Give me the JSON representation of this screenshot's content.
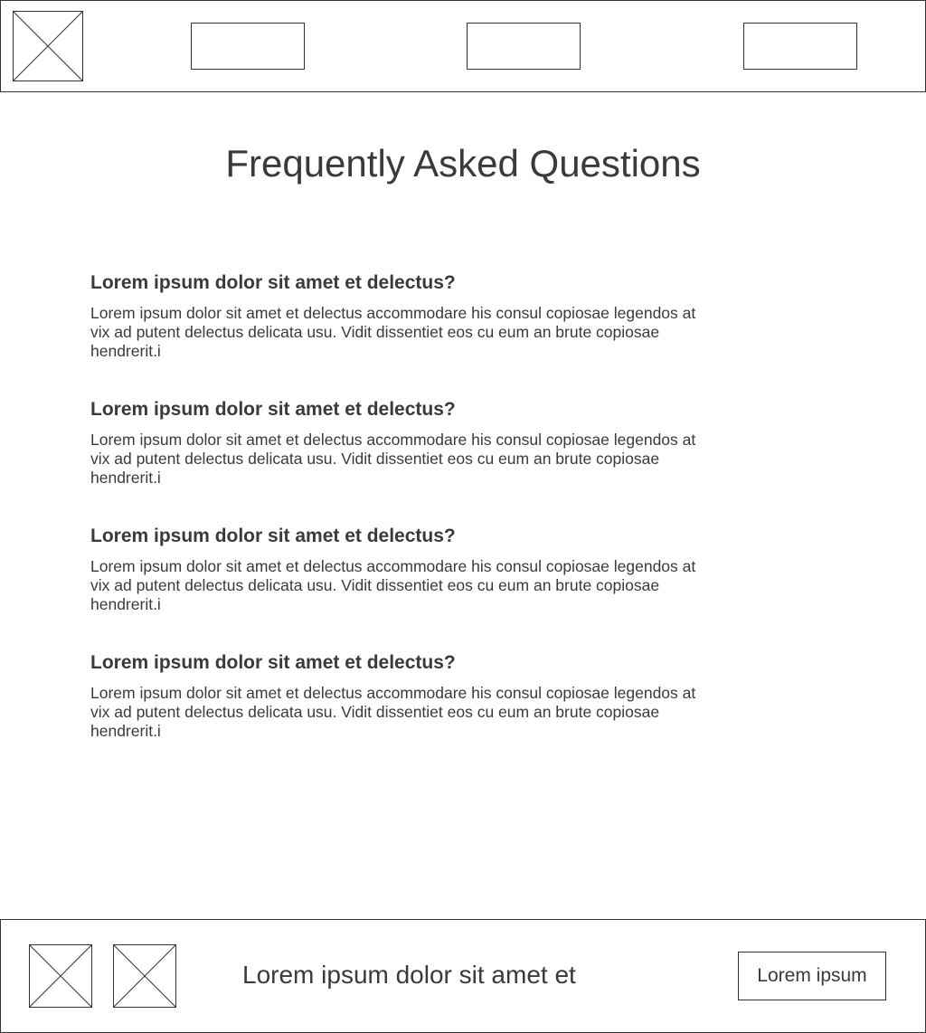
{
  "header": {
    "nav_items": [
      "",
      "",
      ""
    ]
  },
  "main": {
    "title": "Frequently Asked Questions",
    "faq": [
      {
        "question": "Lorem ipsum dolor sit amet et delectus?",
        "answer": "Lorem ipsum dolor sit amet et delectus accommodare his consul copiosae legendos at vix ad putent delectus delicata usu. Vidit dissentiet eos cu eum an brute copiosae hendrerit.i"
      },
      {
        "question": "Lorem ipsum dolor sit amet et delectus?",
        "answer": "Lorem ipsum dolor sit amet et delectus accommodare his consul copiosae legendos at vix ad putent delectus delicata usu. Vidit dissentiet eos cu eum an brute copiosae hendrerit.i"
      },
      {
        "question": "Lorem ipsum dolor sit amet et delectus?",
        "answer": "Lorem ipsum dolor sit amet et delectus accommodare his consul copiosae legendos at vix ad putent delectus delicata usu. Vidit dissentiet eos cu eum an brute copiosae hendrerit.i"
      },
      {
        "question": "Lorem ipsum dolor sit amet et delectus?",
        "answer": "Lorem ipsum dolor sit amet et delectus accommodare his consul copiosae legendos at vix ad putent delectus delicata usu. Vidit dissentiet eos cu eum an brute copiosae hendrerit.i"
      }
    ]
  },
  "footer": {
    "text": "Lorem ipsum dolor sit amet et",
    "button_label": "Lorem ipsum"
  },
  "colors": {
    "text": "#3a3a3a",
    "border": "#333333",
    "background": "#ffffff"
  },
  "icons": {
    "logo": "image-placeholder-icon",
    "footer_images": [
      "image-placeholder-icon",
      "image-placeholder-icon"
    ]
  }
}
